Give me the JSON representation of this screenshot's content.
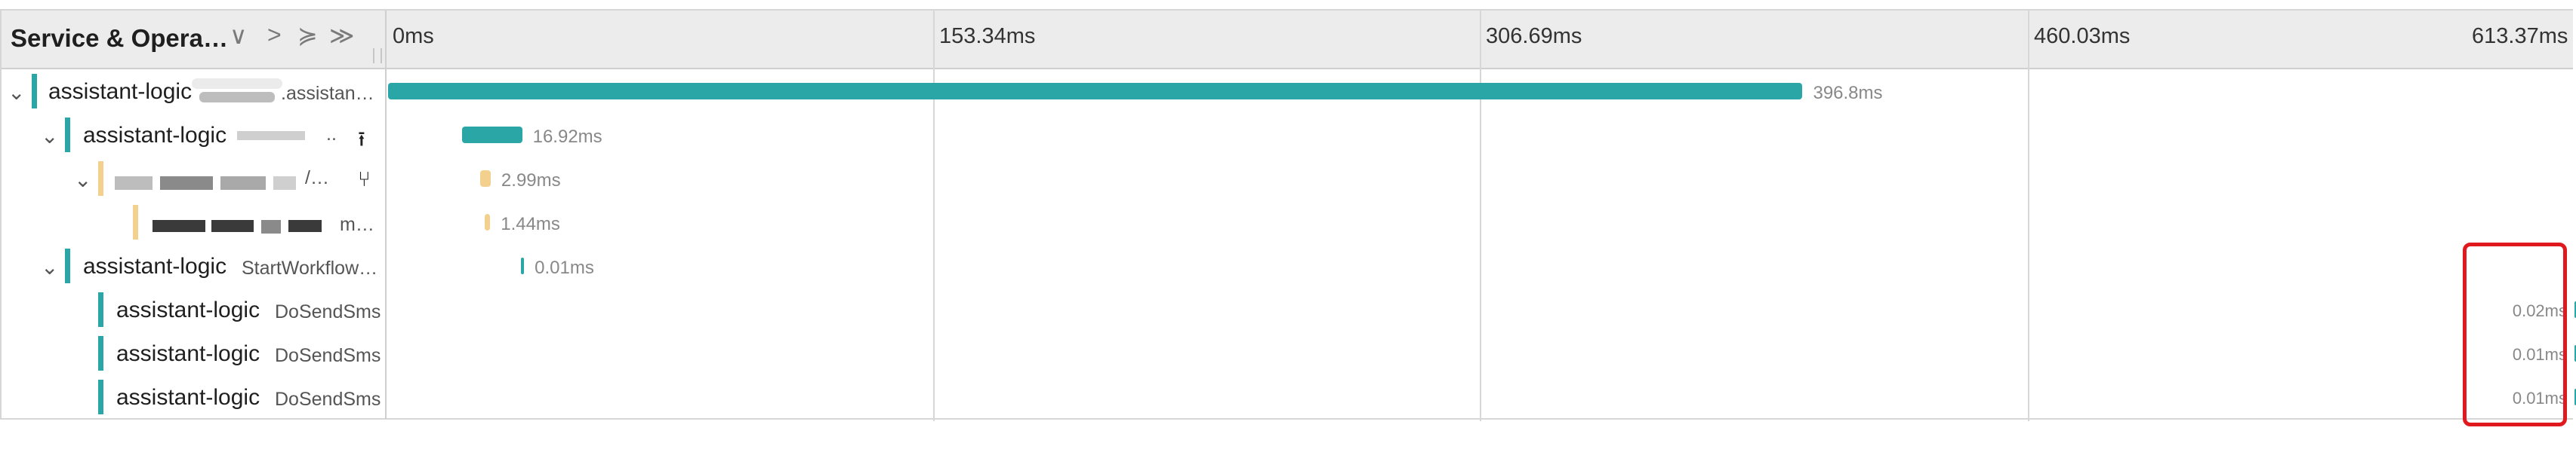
{
  "colors": {
    "teal": "#2aa6a6",
    "amber": "#f3d08e",
    "highlight": "#e0191e"
  },
  "header": {
    "title": "Service & Opera…",
    "controls": [
      "∨",
      ">",
      "≽",
      "≫"
    ],
    "ticks": [
      "0ms",
      "153.34ms",
      "306.69ms",
      "460.03ms",
      "613.37ms"
    ]
  },
  "rows": [
    {
      "service": "assistant-logic",
      "operation": ".assistan…",
      "duration": "396.8ms",
      "color": "teal",
      "start_ms": 0,
      "duration_ms": 396.8
    },
    {
      "service": "assistant-logic",
      "operation": "..",
      "duration": "16.92ms",
      "color": "teal",
      "start_ms": 20.7,
      "duration_ms": 16.92
    },
    {
      "service": "",
      "operation": "/…",
      "duration": "2.99ms",
      "color": "amber",
      "start_ms": 25.8,
      "duration_ms": 2.99
    },
    {
      "service": "",
      "operation": "m…",
      "duration": "1.44ms",
      "color": "amber",
      "start_ms": 27.2,
      "duration_ms": 1.44
    },
    {
      "service": "assistant-logic",
      "operation": "StartWorkflow…",
      "duration": "0.01ms",
      "color": "teal",
      "start_ms": 37.3,
      "duration_ms": 0.01
    },
    {
      "service": "assistant-logic",
      "operation": "DoSendSms",
      "duration": "0.02ms",
      "color": "teal",
      "start_ms": 613.3,
      "duration_ms": 0.02
    },
    {
      "service": "assistant-logic",
      "operation": "DoSendSms",
      "duration": "0.01ms",
      "color": "teal",
      "start_ms": 613.3,
      "duration_ms": 0.01
    },
    {
      "service": "assistant-logic",
      "operation": "DoSendSms",
      "duration": "0.01ms",
      "color": "teal",
      "start_ms": 613.3,
      "duration_ms": 0.01
    }
  ]
}
